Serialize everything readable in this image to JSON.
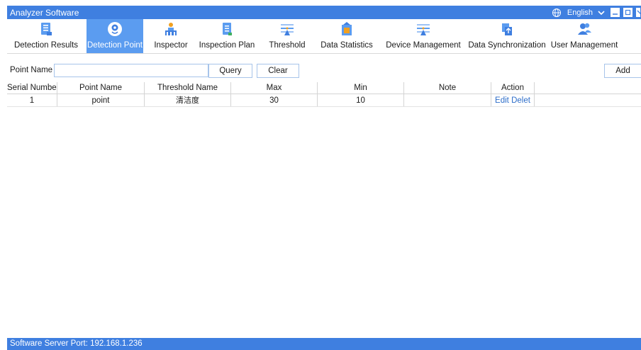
{
  "window": {
    "title": "Analyzer Software",
    "language": "English",
    "accent_color": "#3f7fe0",
    "active_tab_color": "#5b9cf0"
  },
  "toolbar": {
    "tabs": [
      {
        "label": "Detection Results",
        "icon": "report-icon"
      },
      {
        "label": "Detection Point",
        "icon": "location-pin-icon",
        "active": true
      },
      {
        "label": "Inspector",
        "icon": "inspector-person-icon"
      },
      {
        "label": "Inspection Plan",
        "icon": "plan-document-icon"
      },
      {
        "label": "Threshold",
        "icon": "threshold-icon"
      },
      {
        "label": "Data Statistics",
        "icon": "statistics-icon"
      },
      {
        "label": "Device Management",
        "icon": "device-icon"
      },
      {
        "label": "Data Synchronization",
        "icon": "sync-icon"
      },
      {
        "label": "User Management",
        "icon": "users-icon"
      }
    ]
  },
  "search": {
    "label": "Point Name",
    "value": "",
    "query_label": "Query",
    "clear_label": "Clear",
    "add_label": "Add"
  },
  "table": {
    "columns": [
      "Serial Number",
      "Point Name",
      "Threshold Name",
      "Max",
      "Min",
      "Note",
      "Action"
    ],
    "rows": [
      {
        "serial": "1",
        "point_name": "point",
        "threshold_name": "清洁度",
        "max": "30",
        "min": "10",
        "note": "",
        "edit_label": "Edit",
        "delete_label": "Delet"
      }
    ]
  },
  "status": {
    "text": "Software Server Port: 192.168.1.236"
  }
}
